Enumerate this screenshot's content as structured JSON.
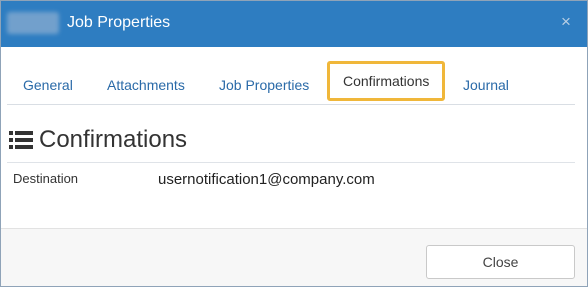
{
  "dialog": {
    "title": "Job Properties",
    "close_glyph": "×"
  },
  "tabs": [
    {
      "label": "General"
    },
    {
      "label": "Attachments"
    },
    {
      "label": "Job Properties"
    },
    {
      "label": "Confirmations",
      "active": true
    },
    {
      "label": "Journal"
    }
  ],
  "section": {
    "icon": "list-icon",
    "title": "Confirmations"
  },
  "fields": {
    "destination_label": "Destination",
    "destination_value": "usernotification1@company.com"
  },
  "footer": {
    "close_label": "Close"
  },
  "colors": {
    "titlebar": "#2e7dc1",
    "tab_link": "#2a6aa8",
    "active_tab_highlight": "#f0b73a"
  }
}
